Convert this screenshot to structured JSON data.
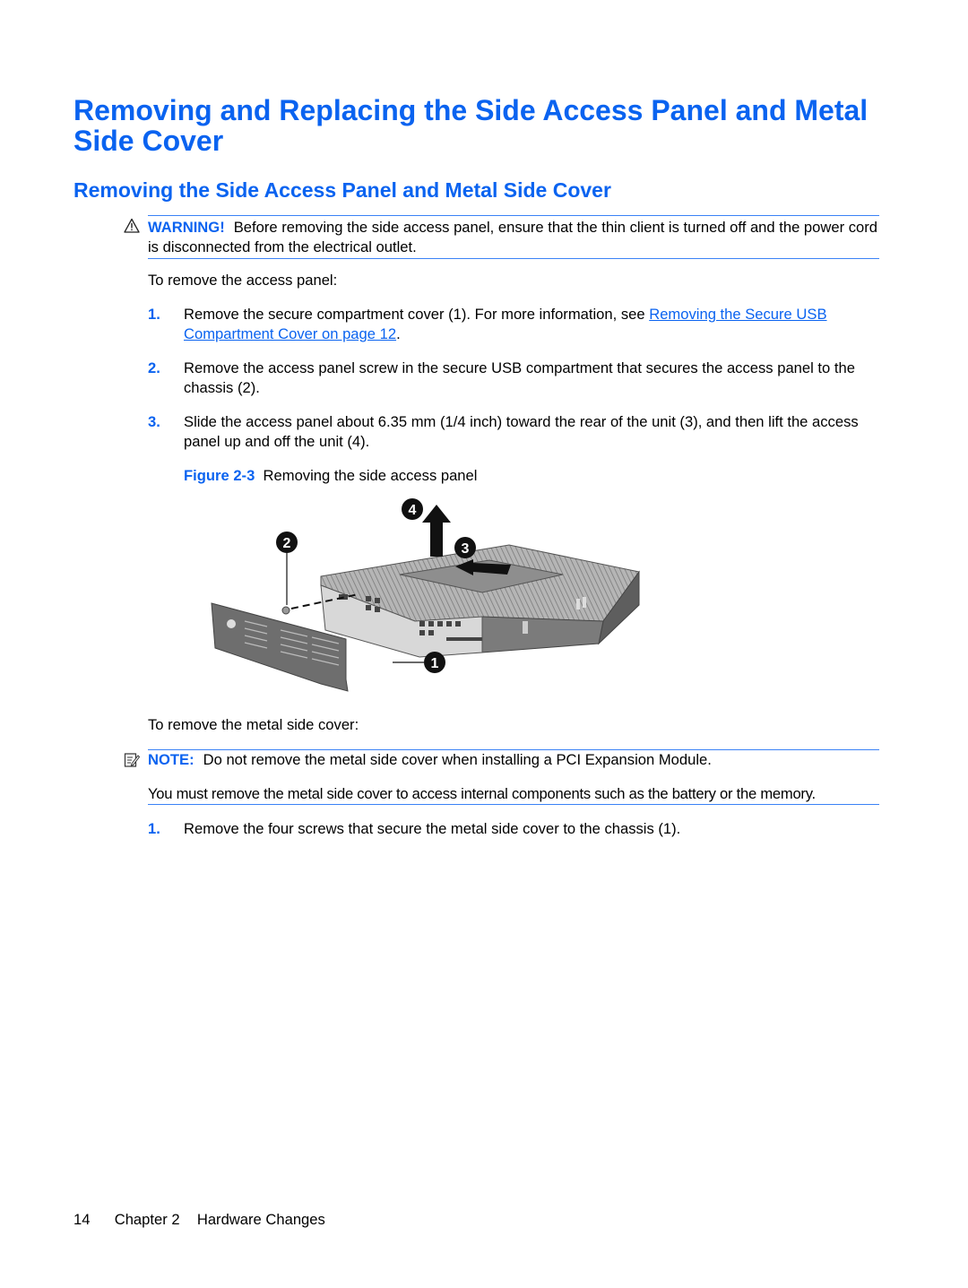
{
  "heading": {
    "title": "Removing and Replacing the Side Access Panel and Metal Side Cover",
    "subtitle": "Removing the Side Access Panel and Metal Side Cover"
  },
  "warning": {
    "icon": "warning-triangle-icon",
    "label": "WARNING!",
    "text": "Before removing the side access panel, ensure that the thin client is turned off and the power cord is disconnected from the electrical outlet."
  },
  "intro_access_panel": "To remove the access panel:",
  "access_panel_steps": [
    {
      "number": "1.",
      "text_before": "Remove the secure compartment cover (1). For more information, see ",
      "link": "Removing the Secure USB Compartment Cover on page 12",
      "text_after": "."
    },
    {
      "number": "2.",
      "text": "Remove the access panel screw in the secure USB compartment that secures the access panel to the chassis (2)."
    },
    {
      "number": "3.",
      "text": "Slide the access panel about 6.35 mm (1/4 inch) toward the rear of the unit (3), and then lift the access panel up and off the unit (4)."
    }
  ],
  "figure": {
    "label": "Figure 2-3",
    "caption": "Removing the side access panel",
    "callouts": [
      "1",
      "2",
      "3",
      "4"
    ]
  },
  "intro_metal_cover": "To remove the metal side cover:",
  "note": {
    "icon": "note-pencil-icon",
    "label": "NOTE:",
    "text": "Do not remove the metal side cover when installing a PCI Expansion Module.",
    "extra": "You must remove the metal side cover to access internal components such as the battery or the memory."
  },
  "metal_cover_steps": [
    {
      "number": "1.",
      "text": "Remove the four screws that secure the metal side cover to the chassis (1)."
    }
  ],
  "footer": {
    "page_number": "14",
    "chapter": "Chapter 2",
    "chapter_title": "Hardware Changes"
  },
  "colors": {
    "accent": "#0a63f0",
    "rule": "#3b82f6"
  }
}
